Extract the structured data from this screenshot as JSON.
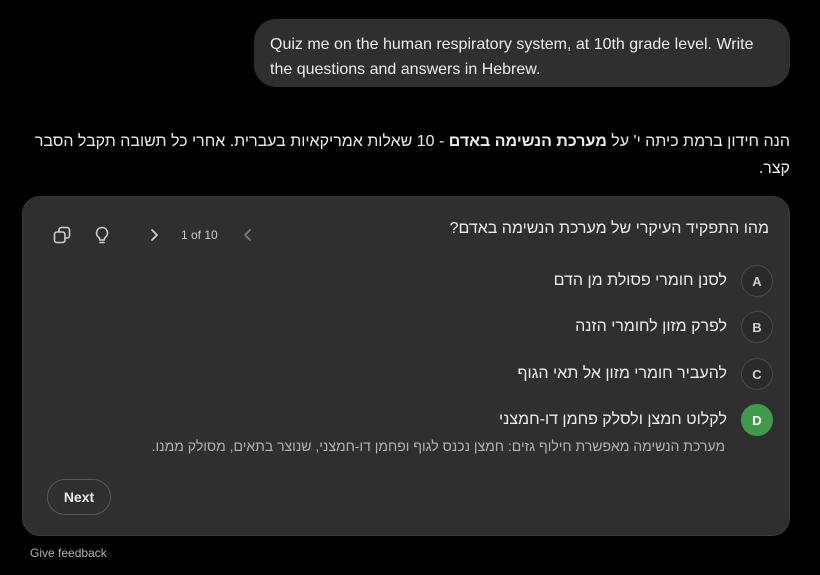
{
  "user_message": "Quiz me on the human respiratory system, at 10th grade level. Write the questions and answers in Hebrew.",
  "assistant": {
    "intro_before": "הנה חידון ברמת כיתה י' על ",
    "intro_bold": "מערכת הנשימה באדם",
    "intro_after": " - 10 שאלות אמריקאיות בעברית. אחרי כל תשובה תקבל הסבר קצר."
  },
  "quiz": {
    "counter": "1 of 10",
    "question": "מהו התפקיד העיקרי של מערכת הנשימה באדם?",
    "options": [
      {
        "letter": "A",
        "text": "לסנן חומרי פסולת מן הדם"
      },
      {
        "letter": "B",
        "text": "לפרק מזון לחומרי הזנה"
      },
      {
        "letter": "C",
        "text": "להעביר חומרי מזון אל תאי הגוף"
      },
      {
        "letter": "D",
        "text": "לקלוט חמצן ולסלק פחמן דו-חמצני"
      }
    ],
    "correct_letter": "D",
    "explanation": "מערכת הנשימה מאפשרת חילוף גזים: חמצן נכנס לגוף ופחמן דו-חמצני, שנוצר בתאים, מסולק ממנו.",
    "next_label": "Next",
    "icons": {
      "copy": "copy-icon",
      "hint": "lightbulb-icon",
      "next": "chevron-right-icon",
      "prev": "chevron-left-icon"
    }
  },
  "feedback_label": "Give feedback",
  "colors": {
    "background": "#000000",
    "card": "#2f2f2f",
    "correct": "#3f9a4b",
    "text": "#ececec"
  }
}
